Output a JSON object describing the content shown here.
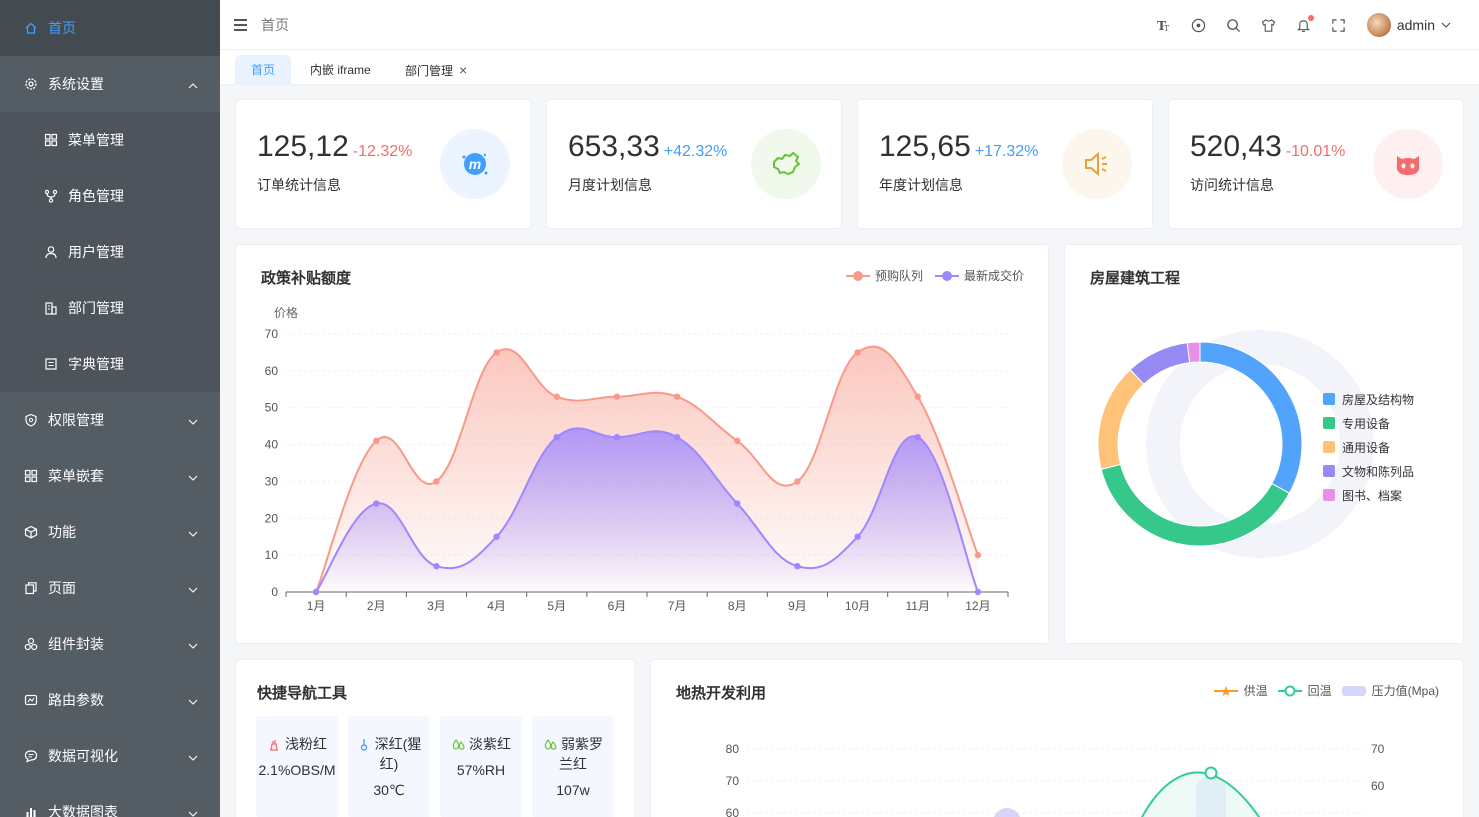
{
  "sidebar": {
    "items": [
      {
        "label": "首页",
        "icon": "home-icon",
        "active": true
      },
      {
        "label": "系统设置",
        "icon": "gear-icon",
        "expanded": true
      },
      {
        "label": "菜单管理",
        "icon": "grid-icon",
        "sub": true
      },
      {
        "label": "角色管理",
        "icon": "branch-icon",
        "sub": true
      },
      {
        "label": "用户管理",
        "icon": "user-icon",
        "sub": true
      },
      {
        "label": "部门管理",
        "icon": "building-icon",
        "sub": true
      },
      {
        "label": "字典管理",
        "icon": "dictionary-icon",
        "sub": true
      },
      {
        "label": "权限管理",
        "icon": "shield-icon"
      },
      {
        "label": "菜单嵌套",
        "icon": "grid-icon"
      },
      {
        "label": "功能",
        "icon": "cube-icon"
      },
      {
        "label": "页面",
        "icon": "copy-icon"
      },
      {
        "label": "组件封装",
        "icon": "components-icon"
      },
      {
        "label": "路由参数",
        "icon": "route-icon"
      },
      {
        "label": "数据可视化",
        "icon": "chat-icon"
      },
      {
        "label": "大数据图表",
        "icon": "bar-chart-icon"
      }
    ]
  },
  "header": {
    "breadcrumb": "首页",
    "username": "admin",
    "icons": [
      "font-size-icon",
      "theme-icon",
      "search-icon",
      "tshirt-icon",
      "bell-icon",
      "fullscreen-icon"
    ]
  },
  "tabs": [
    {
      "label": "首页",
      "active": true
    },
    {
      "label": "内嵌 iframe"
    },
    {
      "label": "部门管理",
      "closable": true,
      "close": "×"
    }
  ],
  "stats": [
    {
      "value": "125,12",
      "pct": "-12.32%",
      "trend": "down",
      "label": "订单统计信息",
      "icon": "meetup-icon",
      "bg": "#ecf5ff",
      "fg": "#409eff"
    },
    {
      "value": "653,33",
      "pct": "+42.32%",
      "trend": "up",
      "label": "月度计划信息",
      "icon": "china-map-icon",
      "bg": "#f0f9eb",
      "fg": "#67c23a"
    },
    {
      "value": "125,65",
      "pct": "+17.32%",
      "trend": "up",
      "label": "年度计划信息",
      "icon": "speaker-icon",
      "bg": "#fdf6ec",
      "fg": "#e6a23c"
    },
    {
      "value": "520,43",
      "pct": "-10.01%",
      "trend": "down",
      "label": "访问统计信息",
      "icon": "github-cat-icon",
      "bg": "#fef0f0",
      "fg": "#f56c6c"
    }
  ],
  "policy_chart": {
    "title": "政策补贴额度"
  },
  "building_chart": {
    "title": "房屋建筑工程"
  },
  "nav_tools": {
    "title": "快捷导航工具",
    "items": [
      {
        "label": "浅粉红",
        "value": "2.1%OBS/M",
        "icon": "pink-icon",
        "color": "#f56c6c"
      },
      {
        "label": "深红(猩红)",
        "value": "30℃",
        "icon": "thermometer-icon",
        "color": "#409eff"
      },
      {
        "label": "淡紫红",
        "value": "57%RH",
        "icon": "humidity-icon",
        "color": "#67c23a"
      },
      {
        "label": "弱紫罗兰红",
        "value": "107w",
        "icon": "power-icon",
        "color": "#67c23a"
      }
    ]
  },
  "geo_chart": {
    "title": "地热开发利用"
  },
  "chart_data": [
    {
      "type": "area",
      "title": "政策补贴额度",
      "ylabel": "价格",
      "categories": [
        "1月",
        "2月",
        "3月",
        "4月",
        "5月",
        "6月",
        "7月",
        "8月",
        "9月",
        "10月",
        "11月",
        "12月"
      ],
      "ylim": [
        0,
        70
      ],
      "yticks": [
        0,
        10,
        20,
        30,
        40,
        50,
        60,
        70
      ],
      "legend": "top-right",
      "series": [
        {
          "name": "预购队列",
          "color": "#f89989",
          "values": [
            0,
            41,
            30,
            65,
            53,
            53,
            53,
            41,
            30,
            65,
            53,
            10
          ]
        },
        {
          "name": "最新成交价",
          "color": "#9e87ff",
          "values": [
            0,
            24,
            7,
            15,
            42,
            42,
            42,
            24,
            7,
            15,
            42,
            0
          ]
        }
      ]
    },
    {
      "type": "pie",
      "title": "房屋建筑工程",
      "legend": "right",
      "labels": [
        "房屋及结构物",
        "专用设备",
        "通用设备",
        "文物和陈列品",
        "图书、档案"
      ],
      "colors": [
        "#51a3fc",
        "#36c78b",
        "#fec279",
        "#968af5",
        "#e790e8"
      ],
      "values": [
        33,
        38,
        17,
        10,
        2
      ]
    },
    {
      "type": "line",
      "title": "地热开发利用",
      "legend": "top-right",
      "series": [
        {
          "name": "供温",
          "color": "#fe9a26"
        },
        {
          "name": "回温",
          "color": "#33cc99"
        },
        {
          "name": "压力值(Mpa)",
          "color": "#d6d6fa"
        }
      ],
      "yticks_left": [
        60,
        70,
        80
      ],
      "yticks_right": [
        60,
        70
      ]
    }
  ]
}
